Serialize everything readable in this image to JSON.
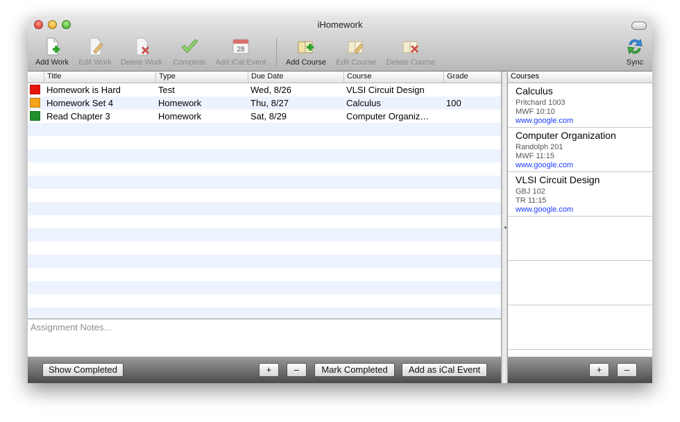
{
  "window": {
    "title": "iHomework"
  },
  "toolbar": {
    "add_work": "Add Work",
    "edit_work": "Edit Work",
    "delete_work": "Delete Work",
    "complete": "Complete",
    "add_ical": "Add iCal Event",
    "ical_day": "28",
    "add_course": "Add Course",
    "edit_course": "Edit Course",
    "delete_course": "Delete Course",
    "sync": "Sync"
  },
  "table": {
    "headers": [
      "Title",
      "Type",
      "Due Date",
      "Course",
      "Grade"
    ],
    "rows": [
      {
        "color": "#e8140e",
        "title": "Homework is Hard",
        "type": "Test",
        "due": "Wed, 8/26",
        "course": "VLSI Circuit Design",
        "grade": ""
      },
      {
        "color": "#f6a21a",
        "title": "Homework Set 4",
        "type": "Homework",
        "due": "Thu, 8/27",
        "course": "Calculus",
        "grade": "100"
      },
      {
        "color": "#1f8f2a",
        "title": "Read Chapter 3",
        "type": "Homework",
        "due": "Sat, 8/29",
        "course": "Computer Organiz…",
        "grade": ""
      }
    ]
  },
  "notes": {
    "placeholder": "Assignment Notes..."
  },
  "bottom": {
    "show_completed": "Show Completed",
    "plus": "+",
    "minus": "–",
    "mark_completed": "Mark Completed",
    "add_ical_event": "Add as iCal Event"
  },
  "courses": {
    "header": "Courses",
    "items": [
      {
        "name": "Calculus",
        "location": "Pritchard 1003",
        "time": "MWF 10:10",
        "url": "www.google.com"
      },
      {
        "name": "Computer Organization",
        "location": "Randolph 201",
        "time": "MWF 11:15",
        "url": "www.google.com"
      },
      {
        "name": "VLSI Circuit Design",
        "location": "GBJ 102",
        "time": "TR 11:15",
        "url": "www.google.com"
      }
    ],
    "plus": "+",
    "minus": "–"
  }
}
